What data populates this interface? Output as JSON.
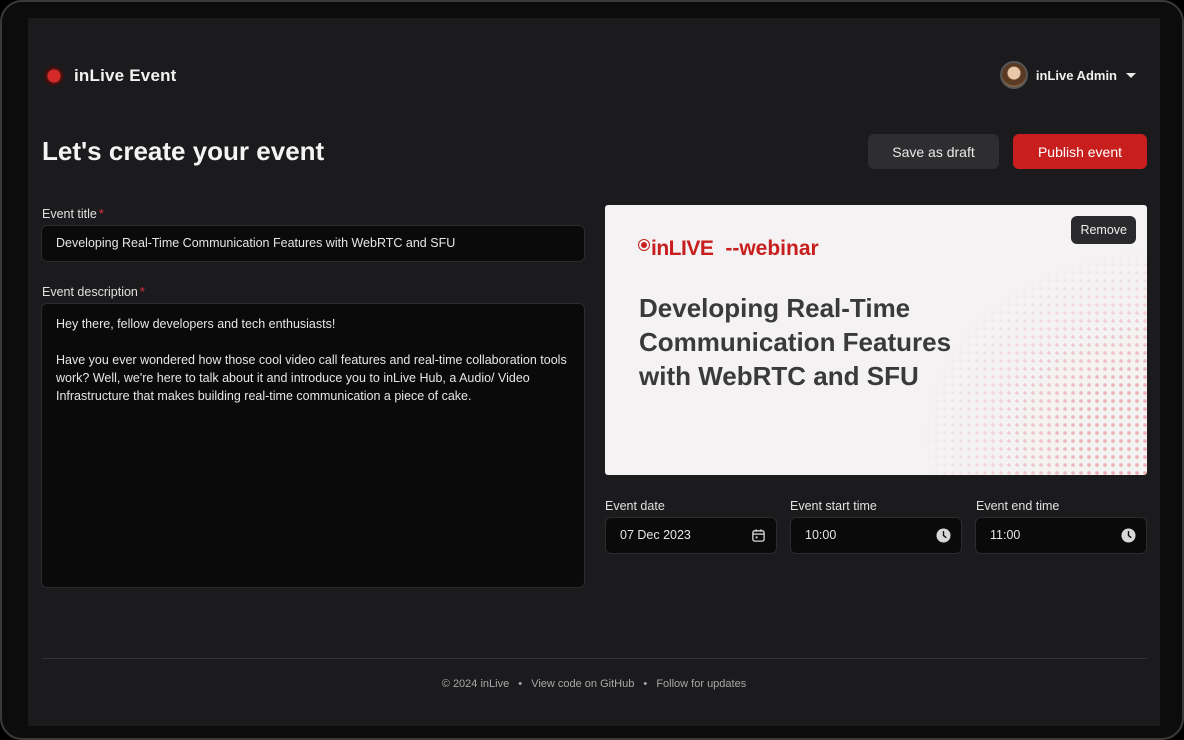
{
  "app": {
    "name": "inLive Event"
  },
  "user": {
    "name": "inLive Admin"
  },
  "page": {
    "title": "Let's create your event"
  },
  "actions": {
    "draft_label": "Save as draft",
    "publish_label": "Publish event"
  },
  "form": {
    "title_label": "Event title",
    "title_value": "Developing Real-Time Communication Features with WebRTC and SFU",
    "description_label": "Event description",
    "description_value": "Hey there, fellow developers and tech enthusiasts!\n\nHave you ever wondered how those cool video call features and real-time collaboration tools work? Well, we're here to talk about it and introduce you to inLive Hub, a Audio/ Video Infrastructure that makes building real-time communication a piece of cake.",
    "required_mark": "*",
    "date_label": "Event date",
    "date_value": "07 Dec 2023",
    "start_label": "Event start time",
    "start_value": "10:00",
    "end_label": "Event end time",
    "end_value": "11:00"
  },
  "banner": {
    "logo": "inLIVE",
    "tag": "--webinar",
    "heading": "Developing Real-Time Communication Features with WebRTC and SFU",
    "remove_label": "Remove"
  },
  "footer": {
    "copyright": "© 2024 inLive",
    "github": "View code on GitHub",
    "follow": "Follow for updates",
    "separator": "•"
  },
  "colors": {
    "accent": "#c81e1e",
    "background": "#1b1b1d",
    "field": "#0a0a0b"
  },
  "icons": {
    "brand": "record-dot-icon",
    "caret": "chevron-down-icon",
    "date": "calendar-icon",
    "time": "clock-icon"
  }
}
